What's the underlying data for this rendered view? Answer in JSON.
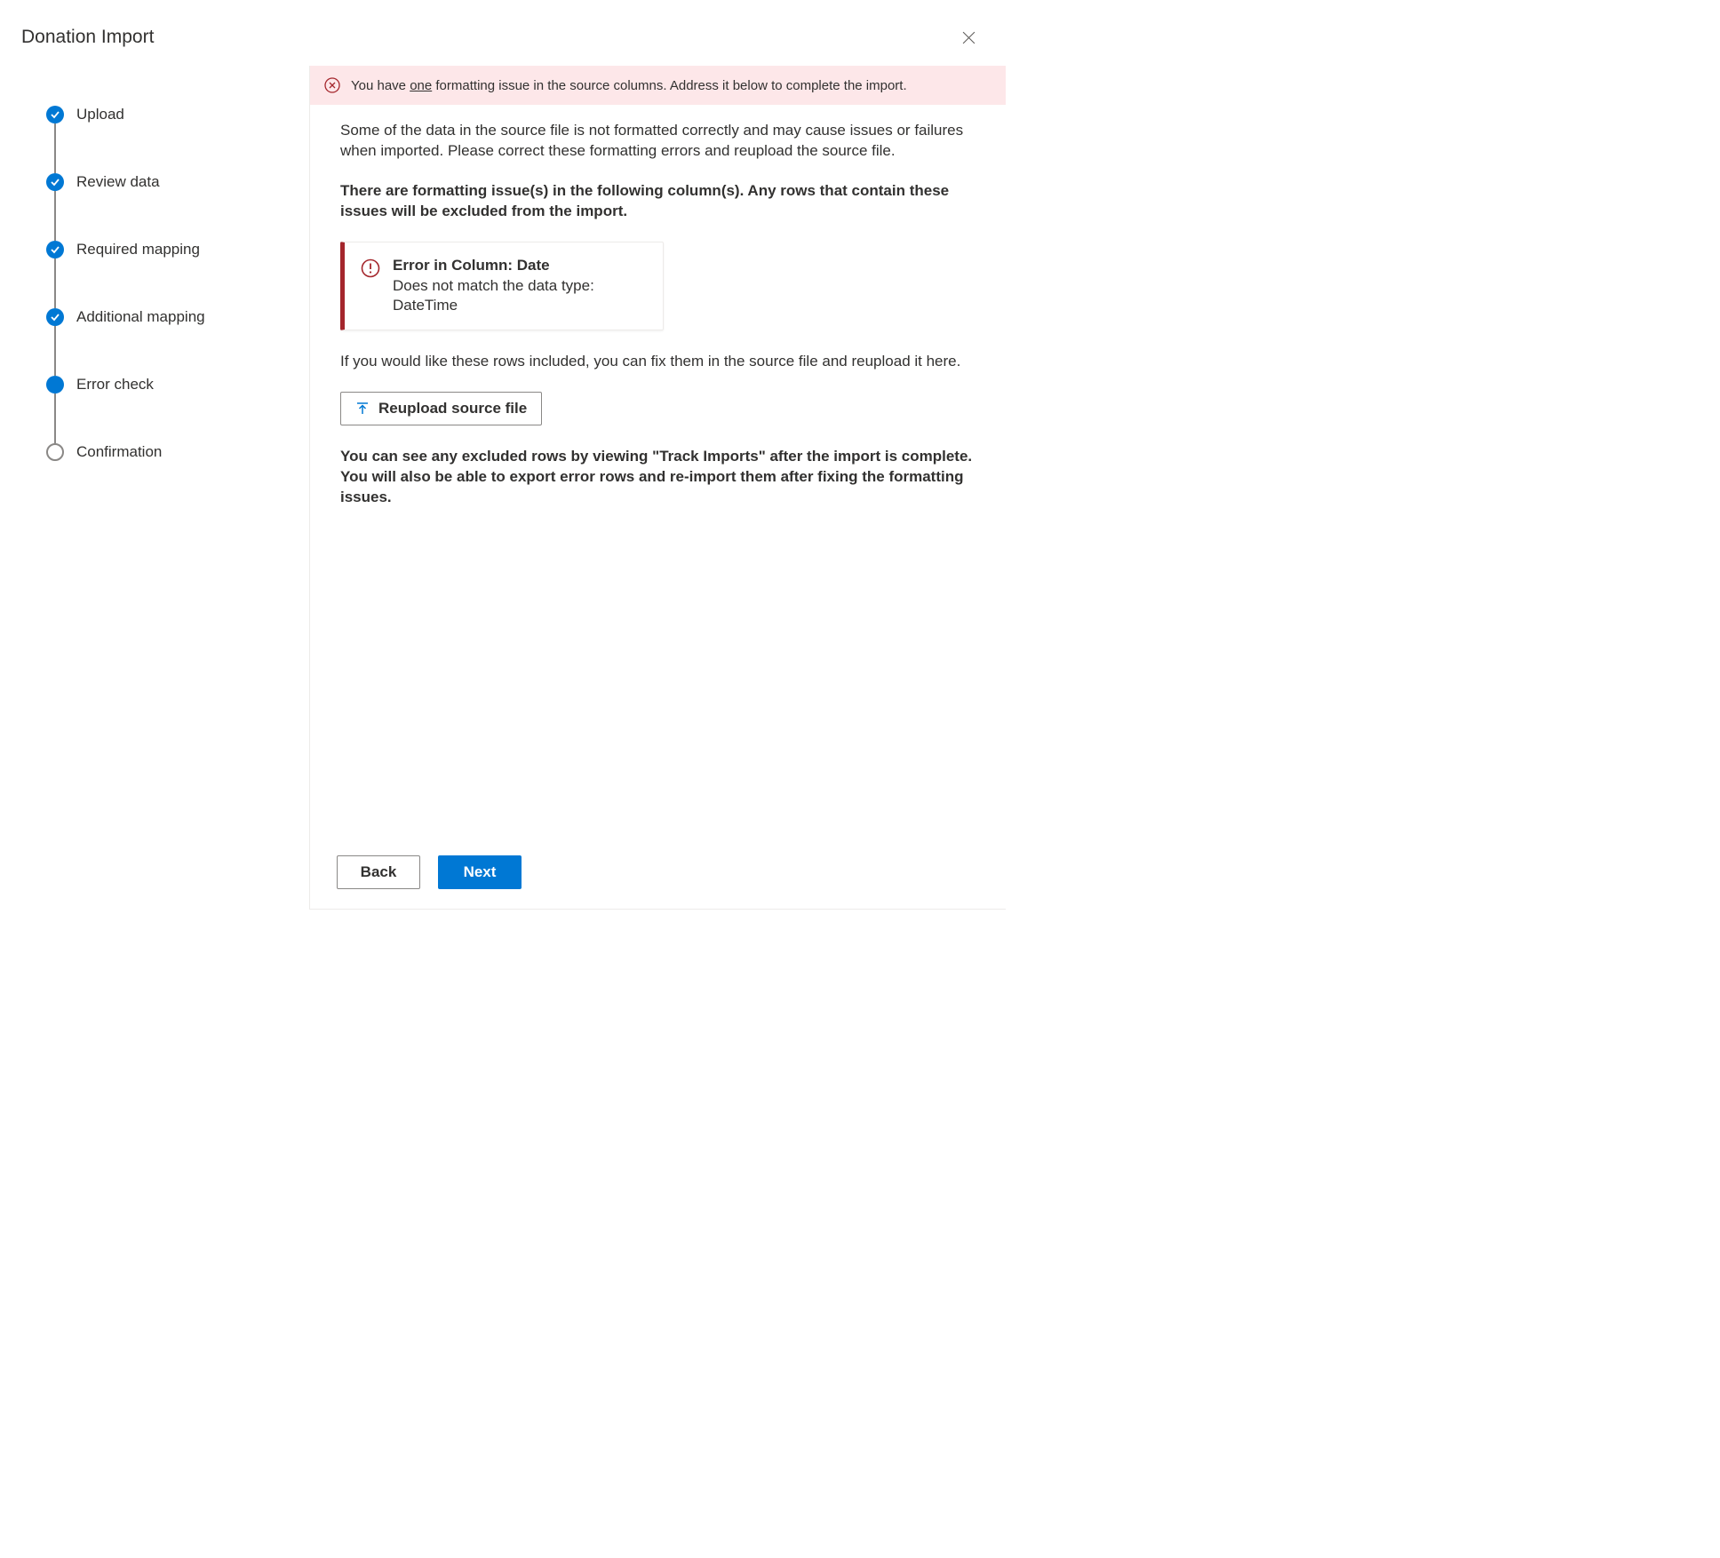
{
  "header": {
    "title": "Donation Import"
  },
  "stepper": {
    "steps": [
      {
        "label": "Upload",
        "state": "completed"
      },
      {
        "label": "Review data",
        "state": "completed"
      },
      {
        "label": "Required mapping",
        "state": "completed"
      },
      {
        "label": "Additional mapping",
        "state": "completed"
      },
      {
        "label": "Error check",
        "state": "current"
      },
      {
        "label": "Confirmation",
        "state": "pending"
      }
    ]
  },
  "alert": {
    "prefix": "You have ",
    "count_word": "one",
    "suffix": " formatting issue in the source columns. Address it below to complete the import."
  },
  "content": {
    "intro": "Some of the data in the source file is not formatted correctly and may cause issues or failures when imported. Please correct these formatting errors and reupload the source file.",
    "issues_heading": "There are formatting issue(s) in the following column(s). Any rows that contain these issues will be excluded from the import.",
    "error_card": {
      "title": "Error in Column: Date",
      "description": "Does not match the data type: DateTime"
    },
    "fix_hint": "If you would like these rows included, you can fix them in the source file and reupload it here.",
    "reupload_label": "Reupload source file",
    "track_hint": "You can see any excluded rows by viewing \"Track Imports\" after the import is complete. You will also be able to export error rows and re-import them after fixing the formatting issues."
  },
  "footer": {
    "back": "Back",
    "next": "Next"
  },
  "colors": {
    "primary": "#0078d4",
    "error": "#a4262c",
    "alert_bg": "#fde7e9"
  }
}
